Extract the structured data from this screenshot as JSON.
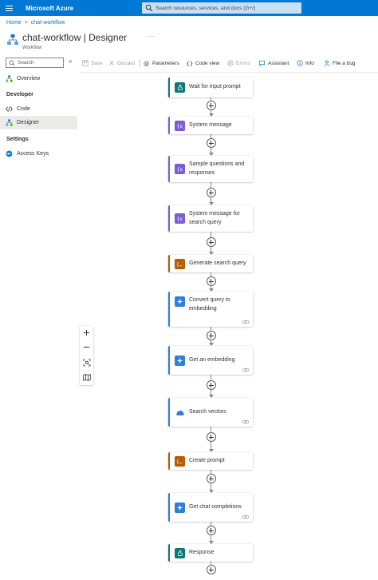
{
  "header": {
    "brand": "Microsoft Azure",
    "search_placeholder": "Search resources, services, and docs (G+/)"
  },
  "breadcrumb": [
    "Home",
    "chat-workflow"
  ],
  "page": {
    "title": "chat-workflow | Designer",
    "subtitle": "Workflow"
  },
  "nav": {
    "search_placeholder": "Search",
    "items_top": [
      {
        "label": "Overview",
        "icon": "overview-icon"
      }
    ],
    "sections": [
      {
        "title": "Developer",
        "items": [
          {
            "label": "Code",
            "icon": "code-icon",
            "selected": false
          },
          {
            "label": "Designer",
            "icon": "designer-icon",
            "selected": true
          }
        ]
      },
      {
        "title": "Settings",
        "items": [
          {
            "label": "Access Keys",
            "icon": "key-icon",
            "selected": false
          }
        ]
      }
    ]
  },
  "toolbar": {
    "save": "Save",
    "discard": "Discard",
    "parameters": "Parameters",
    "code_view": "Code view",
    "errors": "Errors",
    "assistant": "Assistant",
    "info": "Info",
    "file_bug": "File a bug"
  },
  "workflow": {
    "steps": [
      {
        "label": "Wait for input prompt",
        "kind": "trigger",
        "accent": "#0b7a75",
        "icon_bg": "#0b7a75",
        "linked": false
      },
      {
        "label": "System message",
        "kind": "variable",
        "accent": "#7c5cd6",
        "icon_bg": "#7c5cd6",
        "linked": false
      },
      {
        "label": "Sample questions and responses",
        "kind": "variable",
        "accent": "#7c5cd6",
        "icon_bg": "#7c5cd6",
        "linked": false
      },
      {
        "label": "System message for search query",
        "kind": "variable",
        "accent": "#7c5cd6",
        "icon_bg": "#7c5cd6",
        "linked": false
      },
      {
        "label": "Generate search query",
        "kind": "compose",
        "accent": "#b55c00",
        "icon_bg": "#b55c00",
        "linked": false
      },
      {
        "label": "Convert query to embedding",
        "kind": "openai",
        "accent": "#2f7fd8",
        "icon_bg": "#2f7fd8",
        "linked": true
      },
      {
        "label": "Get an embedding",
        "kind": "openai",
        "accent": "#2f7fd8",
        "icon_bg": "#2f7fd8",
        "linked": true
      },
      {
        "label": "Search vectors",
        "kind": "search",
        "accent": "#2f7fd8",
        "icon_bg": "#ffffff",
        "linked": true
      },
      {
        "label": "Create prompt",
        "kind": "compose",
        "accent": "#b55c00",
        "icon_bg": "#b55c00",
        "linked": false
      },
      {
        "label": "Get chat completions",
        "kind": "openai",
        "accent": "#2f7fd8",
        "icon_bg": "#2f7fd8",
        "linked": true
      },
      {
        "label": "Response",
        "kind": "trigger",
        "accent": "#0b7a75",
        "icon_bg": "#0b7a75",
        "linked": false
      }
    ]
  },
  "colors": {
    "topbar": "#0078d4",
    "link": "#0078d4",
    "selected_nav": "#edebe9"
  }
}
